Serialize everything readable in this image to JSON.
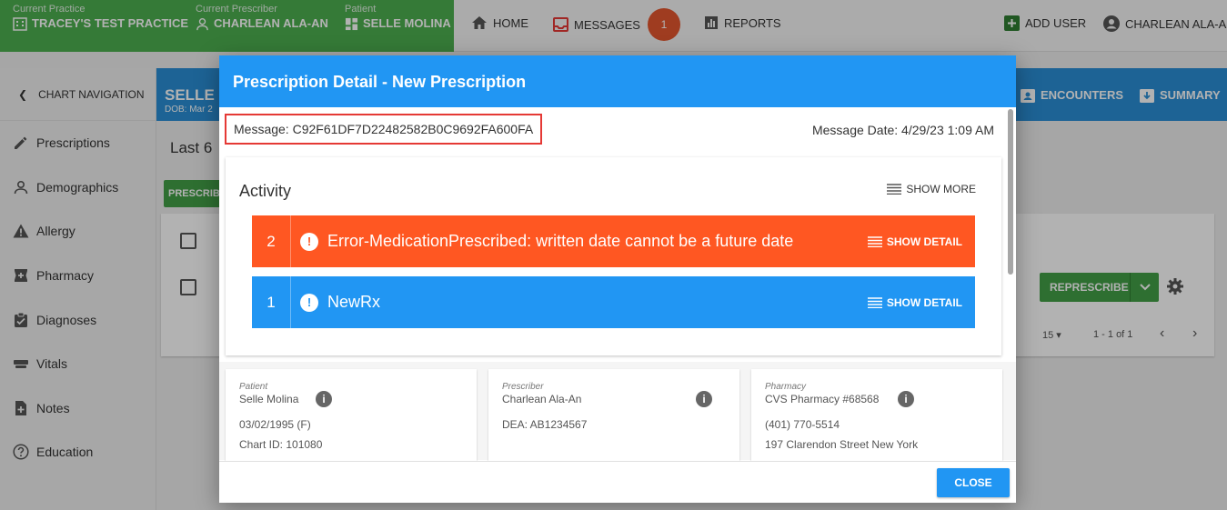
{
  "context": {
    "practice": {
      "label": "Current Practice",
      "value": "TRACEY'S TEST PRACTICE"
    },
    "prescriber": {
      "label": "Current Prescriber",
      "value": "CHARLEAN ALA-AN"
    },
    "patient": {
      "label": "Patient",
      "value": "SELLE MOLINA"
    }
  },
  "topnav": {
    "home": "HOME",
    "messages": "MESSAGES",
    "messages_count": "1",
    "reports": "REPORTS",
    "add_user": "ADD USER",
    "user": "CHARLEAN ALA-AN"
  },
  "sidebar": {
    "chart_nav": "CHART NAVIGATION",
    "items": [
      {
        "label": "Prescriptions",
        "icon": "pencil-icon"
      },
      {
        "label": "Demographics",
        "icon": "person-icon"
      },
      {
        "label": "Allergy",
        "icon": "warning-icon"
      },
      {
        "label": "Pharmacy",
        "icon": "pharmacy-icon"
      },
      {
        "label": "Diagnoses",
        "icon": "clipboard-check-icon"
      },
      {
        "label": "Vitals",
        "icon": "vitals-icon"
      },
      {
        "label": "Notes",
        "icon": "note-add-icon"
      },
      {
        "label": "Education",
        "icon": "help-circle-icon"
      }
    ]
  },
  "patient_header": {
    "name": "SELLE M",
    "dob": "DOB: Mar 2",
    "encounters": "ENCOUNTERS",
    "summary": "SUMMARY"
  },
  "main": {
    "last": "Last 6",
    "prescribe_btn": "PRESCRIB",
    "represcribe": "REPRESCRIBE",
    "per_page": "15",
    "range": "1 - 1 of 1"
  },
  "modal": {
    "title": "Prescription Detail - New Prescription",
    "message": "Message: C92F61DF7D22482582B0C9692FA600FA",
    "message_date": "Message Date: 4/29/23 1:09 AM",
    "activity": {
      "title": "Activity",
      "show_more": "SHOW MORE",
      "rows": [
        {
          "num": "2",
          "text": "Error-MedicationPrescribed: written date cannot be a future date",
          "detail": "SHOW DETAIL",
          "color": "#ff5722"
        },
        {
          "num": "1",
          "text": "NewRx",
          "detail": "SHOW DETAIL",
          "color": "#2196f3"
        }
      ]
    },
    "cards": {
      "patient": {
        "label": "Patient",
        "name": "Selle Molina",
        "line1": "03/02/1995 (F)",
        "line2": "Chart ID: 101080"
      },
      "prescriber": {
        "label": "Prescriber",
        "name": "Charlean Ala-An",
        "line1": "DEA: AB1234567"
      },
      "pharmacy": {
        "label": "Pharmacy",
        "name": "CVS Pharmacy #68568",
        "line1": "(401) 770-5514",
        "line2": "197 Clarendon Street New York"
      }
    },
    "close": "CLOSE"
  },
  "colors": {
    "primary": "#2196f3",
    "green": "#4caf50",
    "error": "#ff5722",
    "badge": "#e4572e"
  }
}
